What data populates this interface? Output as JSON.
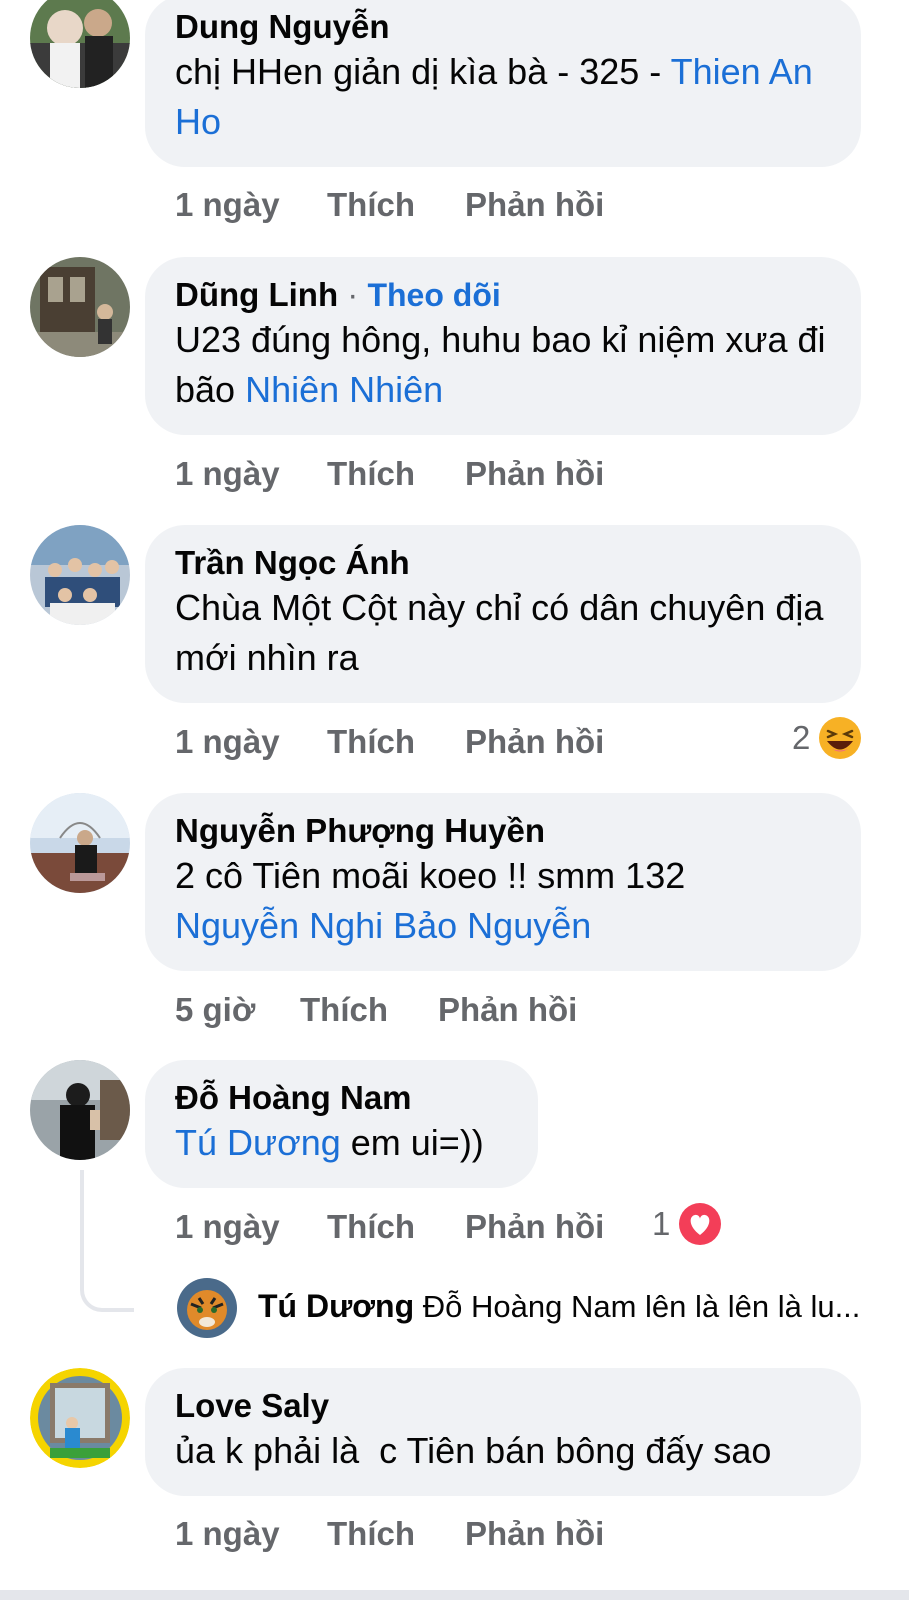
{
  "comments": [
    {
      "author": "Dung Nguyễn",
      "text": "chị HHen giản dị kìa bà - 325 - ",
      "mention": "Thien An Ho",
      "time": "1 ngày",
      "like": "Thích",
      "reply": "Phản hồi"
    },
    {
      "author": "Dũng Linh",
      "follow_sep": " · ",
      "follow": "Theo dõi",
      "text": "U23 đúng hông, huhu bao kỉ niệm xưa đi bão ",
      "mention": "Nhiên Nhiên",
      "time": "1 ngày",
      "like": "Thích",
      "reply": "Phản hồi"
    },
    {
      "author": "Trần Ngọc Ánh",
      "text": "Chùa Một Cột này chỉ có dân chuyên địa mới nhìn ra",
      "time": "1 ngày",
      "like": "Thích",
      "reply": "Phản hồi",
      "reaction_count": "2",
      "reaction_icon": "laugh-emoji-icon"
    },
    {
      "author": "Nguyễn Phượng Huyền",
      "text": "2 cô Tiên moãi koeo !! smm 132",
      "mention": "Nguyễn Nghi Bảo Nguyễn",
      "time": "5 giờ",
      "like": "Thích",
      "reply": "Phản hồi"
    },
    {
      "author": "Đỗ Hoàng Nam",
      "mention": "Tú Dương",
      "text": " em ui=))",
      "time": "1 ngày",
      "like": "Thích",
      "reply": "Phản hồi",
      "reaction_count": "1",
      "reaction_icon": "heart-reaction-icon",
      "reply_preview": {
        "author": "Tú Dương",
        "text": "Đỗ Hoàng Nam lên là lên là lu..."
      }
    },
    {
      "author": "Love Saly",
      "text": "ủa k phải là  c Tiên bán bông đấy sao",
      "time": "1 ngày",
      "like": "Thích",
      "reply": "Phản hồi"
    }
  ],
  "colors": {
    "bubble": "#f0f2f5",
    "link": "#1b6fd6",
    "meta": "#65676b",
    "heart": "#f33e58",
    "laugh": "#f7b125"
  }
}
